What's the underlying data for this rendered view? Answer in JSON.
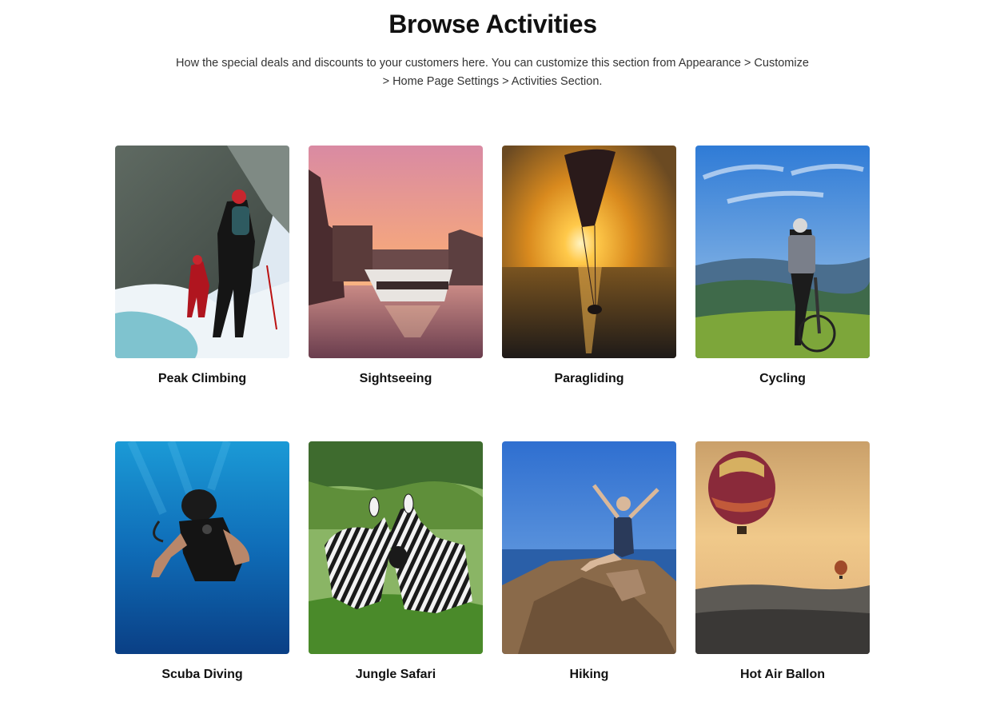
{
  "section": {
    "title": "Browse Activities",
    "description": "How the special deals and discounts to your customers here. You can customize this section from Appearance > Customize > Home Page Settings > Activities Section."
  },
  "activities": [
    {
      "label": "Peak Climbing"
    },
    {
      "label": "Sightseeing"
    },
    {
      "label": "Paragliding"
    },
    {
      "label": "Cycling"
    },
    {
      "label": "Scuba Diving"
    },
    {
      "label": "Jungle Safari"
    },
    {
      "label": "Hiking"
    },
    {
      "label": "Hot Air Ballon"
    }
  ]
}
